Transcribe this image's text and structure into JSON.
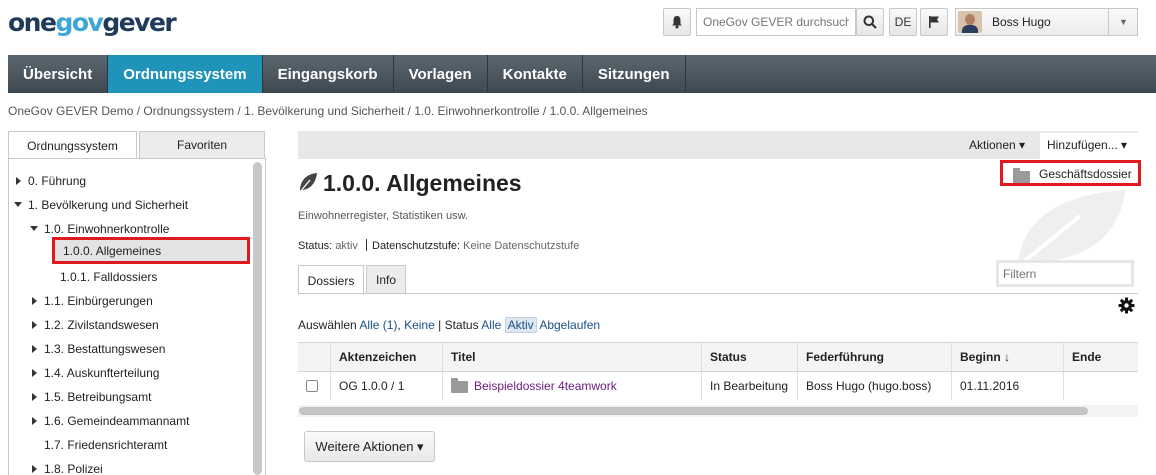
{
  "header": {
    "logo": {
      "part1": "one",
      "part2": "gov",
      "part3": "gever"
    },
    "search_placeholder": "OneGov GEVER durchsuchen",
    "language": "DE",
    "user_name": "Boss Hugo"
  },
  "nav": {
    "items": [
      {
        "label": "Übersicht",
        "active": false
      },
      {
        "label": "Ordnungssystem",
        "active": true
      },
      {
        "label": "Eingangskorb",
        "active": false
      },
      {
        "label": "Vorlagen",
        "active": false
      },
      {
        "label": "Kontakte",
        "active": false
      },
      {
        "label": "Sitzungen",
        "active": false
      }
    ]
  },
  "breadcrumb": "OneGov GEVER Demo / Ordnungssystem / 1. Bevölkerung und Sicherheit / 1.0. Einwohnerkontrolle / 1.0.0. Allgemeines",
  "left_panel": {
    "tabs": [
      "Ordnungssystem",
      "Favoriten"
    ],
    "tree": [
      {
        "label": "0. Führung",
        "state": "collapsed"
      },
      {
        "label": "1. Bevölkerung und Sicherheit",
        "state": "expanded"
      },
      {
        "label": "1.0. Einwohnerkontrolle",
        "state": "expanded"
      },
      {
        "label": "1.0.0. Allgemeines",
        "state": "selected"
      },
      {
        "label": "1.0.1. Falldossiers",
        "state": "leaf"
      },
      {
        "label": "1.1. Einbürgerungen",
        "state": "collapsed"
      },
      {
        "label": "1.2. Zivilstandswesen",
        "state": "collapsed"
      },
      {
        "label": "1.3. Bestattungswesen",
        "state": "collapsed"
      },
      {
        "label": "1.4. Auskunfterteilung",
        "state": "collapsed"
      },
      {
        "label": "1.5. Betreibungsamt",
        "state": "collapsed"
      },
      {
        "label": "1.6. Gemeindeammannamt",
        "state": "collapsed"
      },
      {
        "label": "1.7. Friedensrichteramt",
        "state": "leaf"
      },
      {
        "label": "1.8. Polizei",
        "state": "collapsed"
      }
    ]
  },
  "toolbar": {
    "aktionen": "Aktionen ▾",
    "hinzufuegen": "Hinzufügen... ▾",
    "dropdown_item": "Geschäftsdossier"
  },
  "content": {
    "title": "1.0.0. Allgemeines",
    "description": "Einwohnerregister, Statistiken usw.",
    "status_label": "Status:",
    "status_value": "aktiv",
    "privacy_label": "Datenschutzstufe:",
    "privacy_value": "Keine Datenschutzstufe",
    "filter_placeholder": "Filtern",
    "tabs": [
      "Dossiers",
      "Info"
    ],
    "filterbar": {
      "select_label": "Auswählen",
      "all": "Alle (1)",
      "none": "Keine",
      "status_label": "Status",
      "status_all": "Alle",
      "status_active": "Aktiv",
      "status_expired": "Abgelaufen"
    }
  },
  "table": {
    "columns": [
      "Aktenzeichen",
      "Titel",
      "Status",
      "Federführung",
      "Beginn ↓",
      "Ende"
    ],
    "rows": [
      {
        "aktenzeichen": "OG 1.0.0 / 1",
        "titel": "Beispieldossier 4teamwork",
        "status": "In Bearbeitung",
        "federfuehrung": "Boss Hugo (hugo.boss)",
        "beginn": "01.11.2016",
        "ende": ""
      }
    ]
  },
  "footer": {
    "more_actions": "Weitere Aktionen ▾"
  }
}
